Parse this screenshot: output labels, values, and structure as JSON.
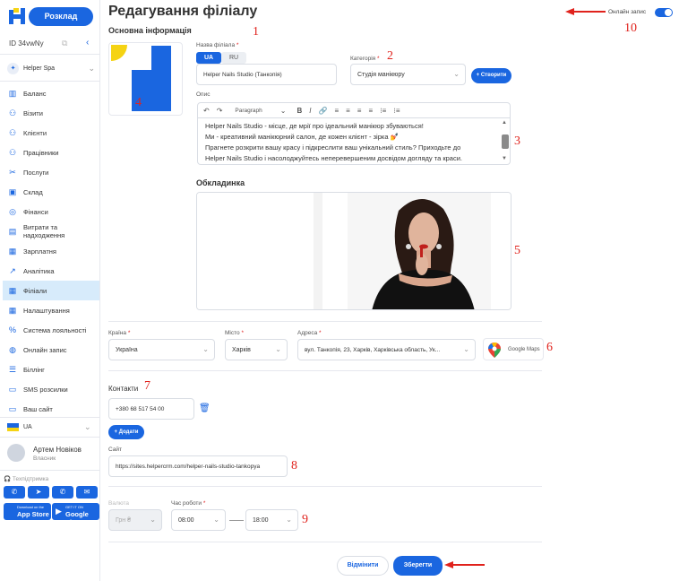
{
  "sidebar": {
    "schedule_label": "Розклад",
    "id_label": "ID 34vwNy",
    "company": "Helper Spa",
    "nav": [
      {
        "label": "Баланс",
        "icon": "chart-icon"
      },
      {
        "label": "Візити",
        "icon": "user-icon"
      },
      {
        "label": "Клієнти",
        "icon": "clients-icon"
      },
      {
        "label": "Працівники",
        "icon": "workers-icon"
      },
      {
        "label": "Послуги",
        "icon": "scissors-icon"
      },
      {
        "label": "Склад",
        "icon": "box-icon"
      },
      {
        "label": "Фінанси",
        "icon": "coin-icon"
      },
      {
        "label": "Витрати та надходження",
        "icon": "wallet-icon"
      },
      {
        "label": "Зарплатня",
        "icon": "salary-icon"
      },
      {
        "label": "Аналітика",
        "icon": "trend-icon"
      },
      {
        "label": "Філіали",
        "icon": "grid-icon",
        "active": true
      },
      {
        "label": "Налаштування",
        "icon": "settings-icon"
      },
      {
        "label": "Система лояльності",
        "icon": "percent-icon"
      },
      {
        "label": "Онлайн запис",
        "icon": "globe-icon"
      },
      {
        "label": "Біллінг",
        "icon": "billing-icon"
      },
      {
        "label": "SMS розсилки",
        "icon": "sms-icon"
      },
      {
        "label": "Ваш сайт",
        "icon": "site-icon"
      }
    ],
    "language": "UA",
    "user_name": "Артем Новіков",
    "user_role": "Власник",
    "support_label": "Техпідтримка",
    "appstore_small": "Download on the",
    "appstore_big": "App Store",
    "googleplay_small": "GET IT ON",
    "googleplay_big": "Google Play"
  },
  "header": {
    "title": "Редагування філіалу",
    "online_label": "Онлайн запис"
  },
  "basic": {
    "section_title": "Основна інформація",
    "name_label": "Назва філіала",
    "lang_tabs": [
      "UA",
      "RU"
    ],
    "name_value": "Helper Nails Studio (Танкопія)",
    "category_label": "Категорія",
    "category_value": "Студія манікюру",
    "create_label": "Створити",
    "desc_label": "Опис",
    "toolbar_style": "Paragraph",
    "description": [
      "Helper Nails Studio - місце, де мрії про ідеальний манікюр збуваються!",
      "Ми - креативний манікюрний салон, де кожен клієнт - зірка 💅",
      "Прагнете розкрити вашу красу і підкреслити ваш унікальний стиль? Приходьте до",
      "Helper Nails Studio і насолоджуйтесь неперевершеним досвідом догляду та краси."
    ],
    "cover_title": "Обкладинка"
  },
  "location": {
    "country_label": "Країна",
    "country_value": "Україна",
    "city_label": "Місто",
    "city_value": "Харків",
    "address_label": "Адреса",
    "address_value": "вул. Танкопія, 23, Харків, Харківська область, Ук...",
    "maps_label": "Google Maps"
  },
  "contacts": {
    "title": "Контакти",
    "phone": "+380 68 517 54 00",
    "add_label": "Додати",
    "site_label": "Сайт",
    "site_value": "https://sites.helpercrm.com/helper-nails-studio-tankopya"
  },
  "settings": {
    "currency_label": "Валюта",
    "currency_value": "Грн ₴",
    "hours_label": "Час роботи",
    "from": "08:00",
    "to": "18:00"
  },
  "actions": {
    "cancel": "Відмінити",
    "save": "Зберегти"
  },
  "annotations": [
    "1",
    "2",
    "3",
    "4",
    "5",
    "6",
    "7",
    "8",
    "9",
    "10"
  ],
  "colors": {
    "accent": "#1a66e0",
    "annotation": "#e0221c",
    "active_nav": "#d7ebfb"
  }
}
